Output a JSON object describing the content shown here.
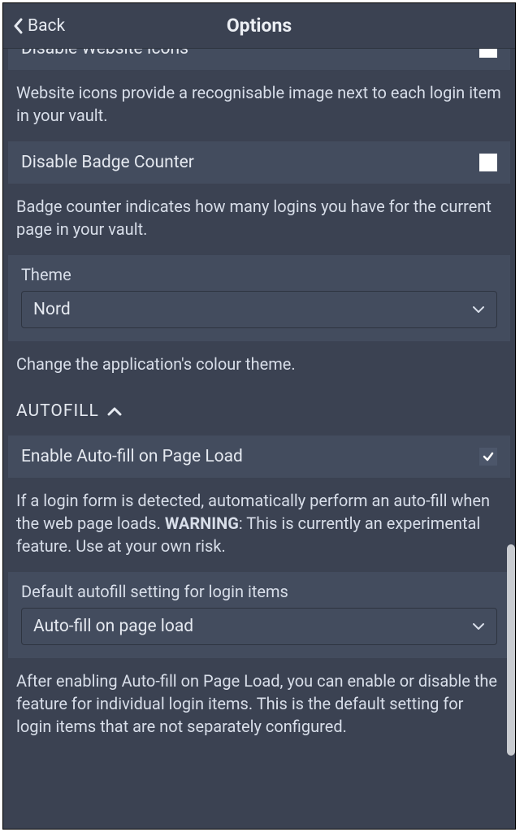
{
  "header": {
    "back_label": "Back",
    "title": "Options"
  },
  "options": {
    "disable_icons": {
      "label": "Disable Website Icons",
      "checked": false,
      "desc": "Website icons provide a recognisable image next to each login item in your vault."
    },
    "disable_badge": {
      "label": "Disable Badge Counter",
      "checked": false,
      "desc": "Badge counter indicates how many logins you have for the current page in your vault."
    },
    "theme": {
      "label": "Theme",
      "value": "Nord",
      "desc": "Change the application's colour theme."
    }
  },
  "autofill": {
    "section_label": "AUTOFILL",
    "enable_on_load": {
      "label": "Enable Auto-fill on Page Load",
      "checked": true,
      "desc_before": "If a login form is detected, automatically perform an auto-fill when the web page loads. ",
      "warning_label": "WARNING",
      "desc_after": ": This is currently an experimental feature. Use at your own risk."
    },
    "default_setting": {
      "label": "Default autofill setting for login items",
      "value": "Auto-fill on page load",
      "desc": "After enabling Auto-fill on Page Load, you can enable or disable the feature for individual login items. This is the default setting for login items that are not separately configured."
    }
  }
}
